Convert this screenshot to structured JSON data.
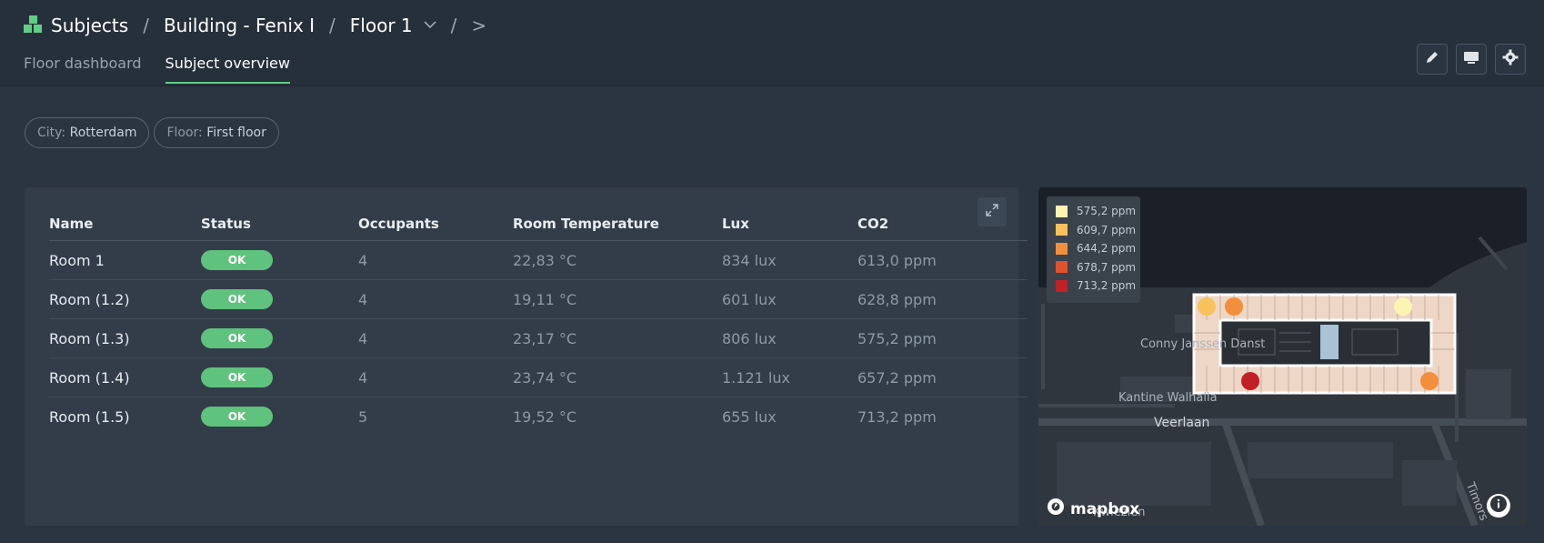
{
  "breadcrumb": {
    "items": [
      "Subjects",
      "Building - Fenix I",
      "Floor 1"
    ],
    "separator": "/",
    "more": ">"
  },
  "tabs": [
    {
      "label": "Floor dashboard",
      "active": false
    },
    {
      "label": "Subject overview",
      "active": true
    }
  ],
  "header_actions": [
    "pencil-icon",
    "monitor-icon",
    "gear-icon"
  ],
  "filters": [
    {
      "key": "City:",
      "value": "Rotterdam"
    },
    {
      "key": "Floor:",
      "value": "First floor"
    }
  ],
  "table": {
    "columns": [
      "Name",
      "Status",
      "Occupants",
      "Room Temperature",
      "Lux",
      "CO2"
    ],
    "rows": [
      {
        "name": "Room 1",
        "status": "OK",
        "occupants": "4",
        "temperature": "22,83 °C",
        "lux": "834 lux",
        "co2": "613,0 ppm"
      },
      {
        "name": "Room (1.2)",
        "status": "OK",
        "occupants": "4",
        "temperature": "19,11 °C",
        "lux": "601 lux",
        "co2": "628,8 ppm"
      },
      {
        "name": "Room (1.3)",
        "status": "OK",
        "occupants": "4",
        "temperature": "23,17 °C",
        "lux": "806 lux",
        "co2": "575,2 ppm"
      },
      {
        "name": "Room (1.4)",
        "status": "OK",
        "occupants": "4",
        "temperature": "23,74 °C",
        "lux": "1.121 lux",
        "co2": "657,2 ppm"
      },
      {
        "name": "Room (1.5)",
        "status": "OK",
        "occupants": "5",
        "temperature": "19,52 °C",
        "lux": "655 lux",
        "co2": "713,2 ppm"
      }
    ]
  },
  "map": {
    "legend": [
      {
        "label": "575,2 ppm",
        "color": "#fdf3b2"
      },
      {
        "label": "609,7 ppm",
        "color": "#f7c15c"
      },
      {
        "label": "644,2 ppm",
        "color": "#f28f3c"
      },
      {
        "label": "678,7 ppm",
        "color": "#e0512c"
      },
      {
        "label": "713,2 ppm",
        "color": "#c31f26"
      }
    ],
    "labels": {
      "conny": "Conny Janssen Danst",
      "kantine": "Kantine Walhalla",
      "veerlaan": "Veerlaan",
      "timor": "Timors",
      "kwiezien": "Kwiezien"
    },
    "brand": "mapbox"
  },
  "colors": {
    "accent": "#5fcf86",
    "ok": "#5fc27d",
    "background": "#2b3541"
  }
}
